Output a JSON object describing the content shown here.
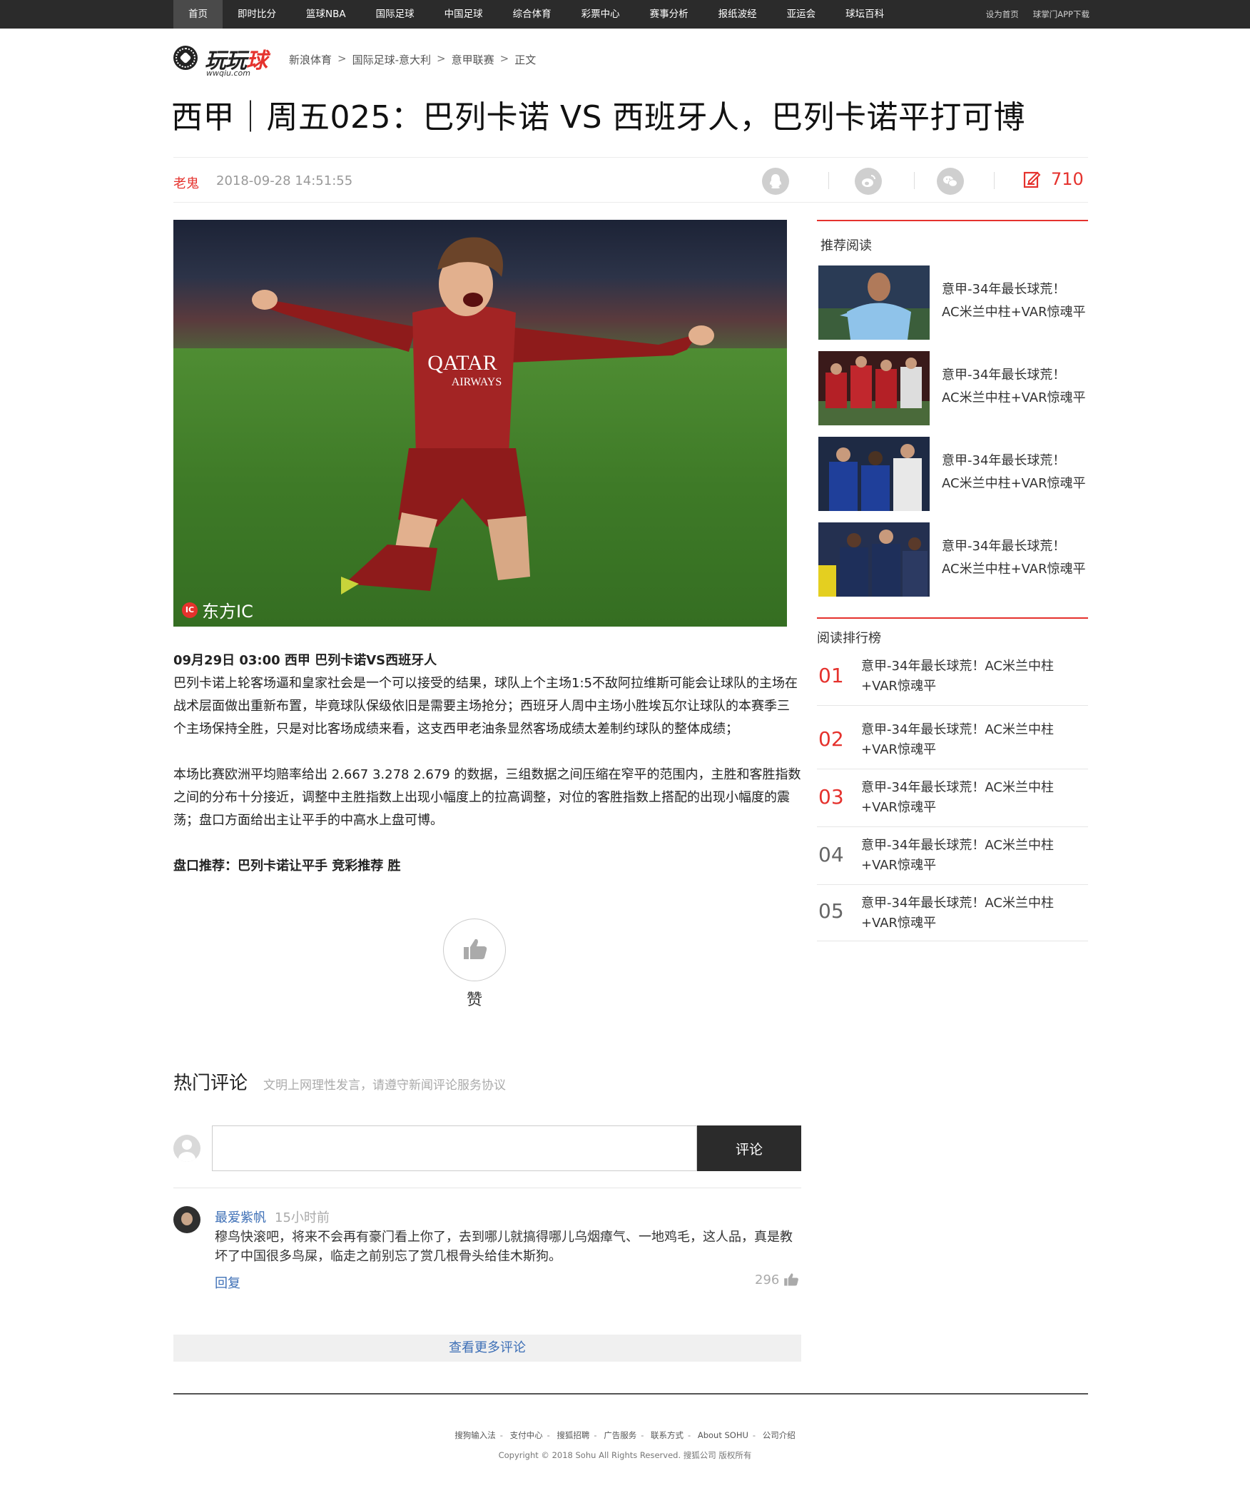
{
  "topnav": {
    "items": [
      {
        "label": "首页",
        "active": true
      },
      {
        "label": "即时比分"
      },
      {
        "label": "篮球NBA"
      },
      {
        "label": "国际足球"
      },
      {
        "label": "中国足球"
      },
      {
        "label": "综合体育"
      },
      {
        "label": "彩票中心"
      },
      {
        "label": "赛事分析"
      },
      {
        "label": "报纸波经"
      },
      {
        "label": "亚运会"
      },
      {
        "label": "球坛百科"
      }
    ],
    "right_links": [
      "设为首页",
      "球掌门APP下载"
    ]
  },
  "logo": {
    "text_black": "玩玩",
    "text_red": "球",
    "sub": "wwqiu.com"
  },
  "breadcrumb": [
    "新浪体育",
    "国际足球-意大利",
    "意甲联赛",
    "正文"
  ],
  "article": {
    "title": "西甲｜周五025：巴列卡诺 VS 西班牙人，巴列卡诺平打可博",
    "author": "老鬼",
    "date": "2018-09-28 14:51:55",
    "comment_count": "710",
    "image_credit": "东方IC",
    "image_credit_mark": "IC",
    "jersey_sponsor": "QATAR",
    "jersey_sponsor_2": "AIRWAYS",
    "body": {
      "headline": "09月29日   03:00   西甲   巴列卡诺VS西班牙人",
      "para1": "巴列卡诺上轮客场逼和皇家社会是一个可以接受的结果，球队上个主场1:5不敌阿拉维斯可能会让球队的主场在战术层面做出重新布置，毕竟球队保级依旧是需要主场抢分；西班牙人周中主场小胜埃瓦尔让球队的本赛季三个主场保持全胜，只是对比客场成绩来看，这支西甲老油条显然客场成绩太差制约球队的整体成绩；",
      "para2": "本场比赛欧洲平均赔率给出 2.667   3.278    2.679 的数据，三组数据之间压缩在窄平的范围内，主胜和客胜指数之间的分布十分接近，调整中主胜指数上出现小幅度上的拉高调整，对位的客胜指数上搭配的出现小幅度的震荡；盘口方面给出主让平手的中高水上盘可博。",
      "recommendation": "盘口推荐：巴列卡诺让平手 竞彩推荐 胜"
    },
    "like_label": "赞"
  },
  "comments": {
    "heading": "热门评论",
    "note": "文明上网理性发言，请遵守新闻评论服务协议",
    "input_value": "",
    "submit_label": "评论",
    "list": [
      {
        "user": "最爱紫帆",
        "time": "15小时前",
        "text": "穆鸟快滚吧，将来不会再有豪门看上你了，去到哪儿就搞得哪儿乌烟瘴气、一地鸡毛，这人品，真是教坏了中国很多鸟屎，临走之前别忘了赏几根骨头给佳木斯狗。",
        "reply_label": "回复",
        "likes": "296"
      }
    ],
    "more_label": "查看更多评论"
  },
  "sidebar": {
    "recommended_heading": "推荐阅读",
    "recommended": [
      {
        "line1": "意甲-34年最长球荒！",
        "line2": "AC米兰中柱+VAR惊魂平"
      },
      {
        "line1": "意甲-34年最长球荒！",
        "line2": "AC米兰中柱+VAR惊魂平"
      },
      {
        "line1": "意甲-34年最长球荒！",
        "line2": "AC米兰中柱+VAR惊魂平"
      },
      {
        "line1": "意甲-34年最长球荒！",
        "line2": "AC米兰中柱+VAR惊魂平"
      }
    ],
    "ranking_heading": "阅读排行榜",
    "ranking": [
      {
        "num": "01",
        "text": "意甲-34年最长球荒！AC米兰中柱+VAR惊魂平"
      },
      {
        "num": "02",
        "text": "意甲-34年最长球荒！AC米兰中柱+VAR惊魂平"
      },
      {
        "num": "03",
        "text": "意甲-34年最长球荒！AC米兰中柱+VAR惊魂平"
      },
      {
        "num": "04",
        "text": "意甲-34年最长球荒！AC米兰中柱+VAR惊魂平"
      },
      {
        "num": "05",
        "text": "意甲-34年最长球荒！AC米兰中柱+VAR惊魂平"
      }
    ]
  },
  "footer": {
    "links": [
      "搜狗输入法",
      "支付中心",
      "搜狐招聘",
      "广告服务",
      "联系方式",
      "About SOHU",
      "公司介绍"
    ],
    "copyright": "Copyright © 2018 Sohu All Rights Reserved. 搜狐公司 版权所有"
  },
  "colors": {
    "accent": "#e5322d",
    "link": "#3d6fb6",
    "nav_bg": "#2b2b2b",
    "rank_hot": "#e5322d",
    "rank_normal": "#666666"
  },
  "icons": [
    "qq-icon",
    "weibo-icon",
    "wechat-icon",
    "comment-edit-icon",
    "thumbs-up-icon",
    "user-placeholder-icon"
  ]
}
